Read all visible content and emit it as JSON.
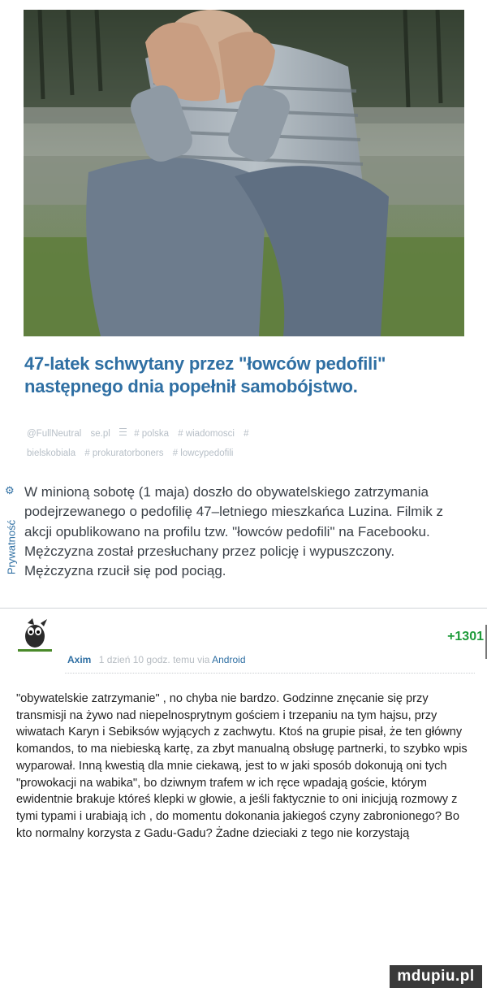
{
  "post": {
    "photo_alt": "",
    "title": "47-latek schwytany przez \"łowców pedofili\" następnego dnia popełnił samobójstwo.",
    "tags": [
      "@FullNeutral",
      "se.pl",
      "# polska",
      "# wiadomosci",
      "#",
      "bielskobiala",
      "# prokuratorboners",
      "# lowcypedofili"
    ],
    "side_label": "Prywatność",
    "body": "W minioną sobotę (1 maja) doszło do obywatelskiego zatrzymania podejrzewanego o pedofilię 47–letniego mieszkańca Luzina. Filmik z akcji opublikowano na profilu tzw. \"łowców pedofili\" na Facebooku. Mężczyzna został przesłuchany przez policję i wypuszczony. Mężczyzna rzucił się pod pociąg."
  },
  "comment": {
    "score": "+1301",
    "author": "Axim",
    "time": "1 dzień 10 godz. temu",
    "via": "via",
    "app": "Android",
    "text": "\"obywatelskie zatrzymanie\" , no chyba nie bardzo. Godzinne znęcanie się przy transmisji na żywo nad niepelnosprytnym gościem i trzepaniu na tym hajsu, przy wiwatach Karyn i Sebiksów wyjących z zachwytu. Ktoś na grupie pisał, że ten główny komandos, to ma niebieską kartę, za zbyt manualną obsługę partnerki, to szybko wpis wyparował. Inną kwestią dla mnie ciekawą, jest to w jaki sposób dokonują oni tych \"prowokacji na wabika\", bo dziwnym trafem w ich ręce wpadają goście, którym ewidentnie brakuje któreś klepki w głowie, a jeśli faktycznie to oni inicjują rozmowy z tymi typami i urabiają ich , do momentu dokonania jakiegoś czyny zabronionego? Bo kto normalny korzysta z Gadu-Gadu? Żadne dzieciaki z tego nie korzystają"
  },
  "watermark": "mdupiu.pl",
  "icons": {
    "gear": "gear-icon",
    "list": "list-icon"
  },
  "colors": {
    "link": "#2f6fa3",
    "score": "#1e9b3a",
    "text": "#3b4148",
    "meta": "#b6bcc2"
  }
}
